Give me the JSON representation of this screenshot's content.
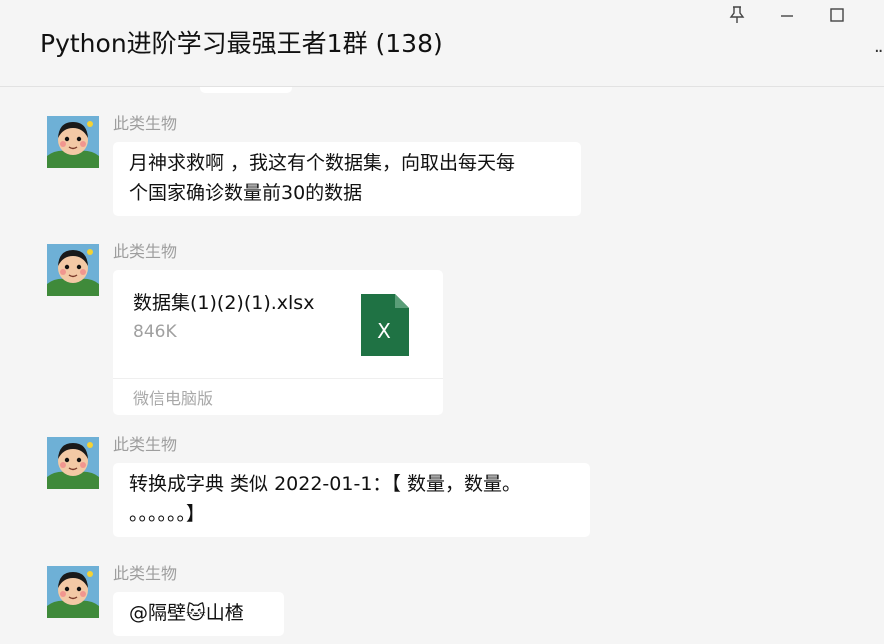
{
  "window": {
    "title": "Python进阶学习最强王者1群 (138)",
    "controls": {
      "pin": "pin-icon",
      "minimize": "minimize-icon",
      "maximize": "maximize-icon",
      "more": "more-icon"
    }
  },
  "messages": [
    {
      "sender": "此类生物",
      "line1": "月神求救啊 ，我这有个数据集，向取出每天每",
      "line2": "个国家确诊数量前30的数据"
    },
    {
      "sender": "此类生物",
      "file": {
        "name": "数据集(1)(2)(1).xlsx",
        "size": "846K",
        "source": "微信电脑版",
        "icon_letter": "X",
        "icon_color": "#1f7244"
      }
    },
    {
      "sender": "此类生物",
      "line1": "转换成字典   类似 2022-01-1：【 数量，数量。",
      "line2": "。。。。。。】"
    },
    {
      "sender": "此类生物",
      "line1": "@隔壁🐱山楂"
    }
  ]
}
